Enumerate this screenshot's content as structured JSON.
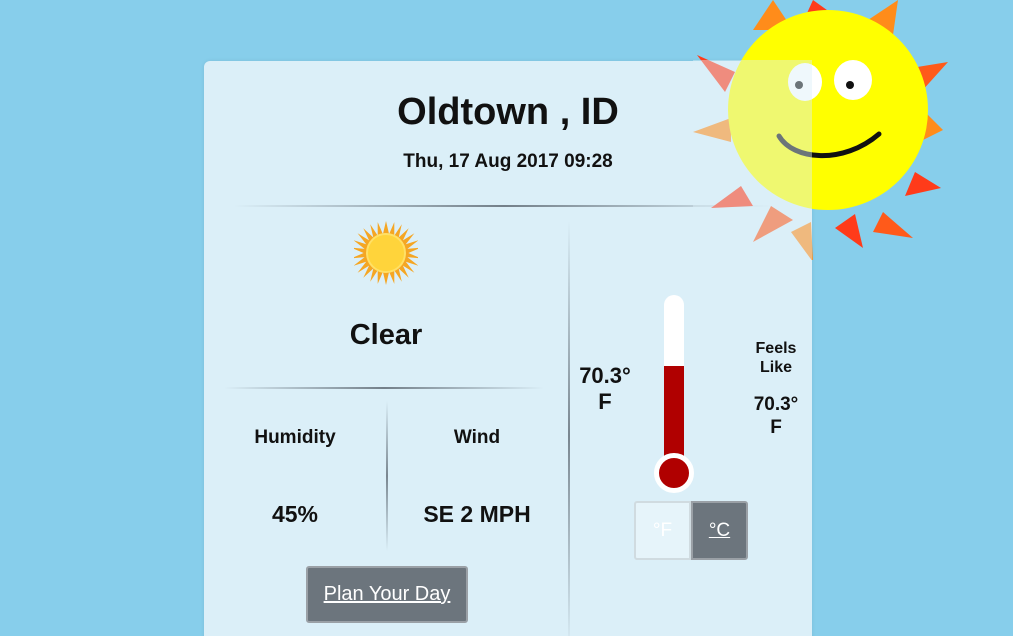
{
  "location": {
    "city": "Oldtown , ID"
  },
  "datetime": "Thu, 17 Aug 2017 09:28",
  "condition": {
    "text": "Clear",
    "icon": "sun-icon"
  },
  "stats": {
    "humidity": {
      "label": "Humidity",
      "value": "45%"
    },
    "wind": {
      "label": "Wind",
      "value": "SE 2 MPH"
    }
  },
  "plan_button": "Plan Your Day",
  "temperature": {
    "value": "70.3°",
    "unit": "F",
    "feels_like_label": "Feels Like",
    "feels_like_value": "70.3°",
    "feels_like_unit": "F",
    "thermometer_fill_fraction": 0.6
  },
  "unit_toggle": {
    "fahrenheit": "°F",
    "celsius": "°C"
  },
  "colors": {
    "background": "#87ceeb",
    "card": "#dbeff8",
    "button": "#6c757d",
    "mercury": "#b00000",
    "sun": "#ffff00"
  }
}
